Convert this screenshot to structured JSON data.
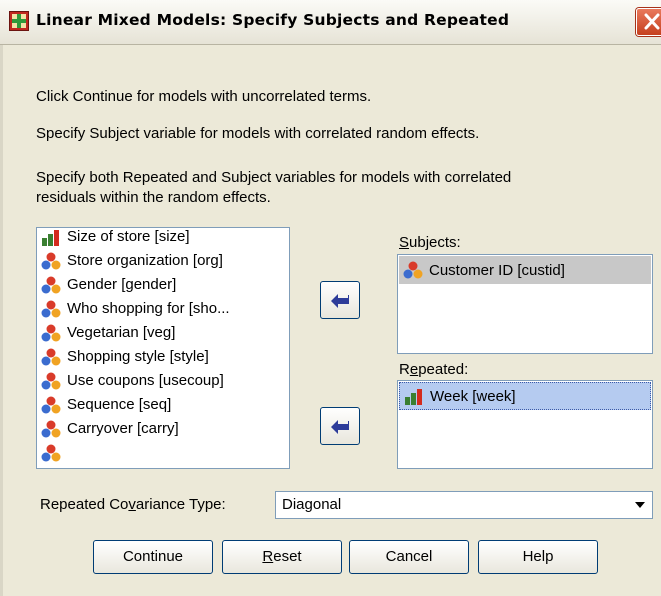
{
  "window": {
    "title": "Linear Mixed Models: Specify Subjects and Repeated"
  },
  "info": {
    "line1": "Click Continue for models with uncorrelated terms.",
    "line2": "Specify Subject variable for models with correlated random effects.",
    "line3a": "Specify both Repeated and Subject variables for models with correlated",
    "line3b": "residuals within the random effects."
  },
  "variables": [
    {
      "label": "Size of store [size]",
      "icon": "ordinal-bar-icon"
    },
    {
      "label": "Store organization [org]",
      "icon": "nominal-icon"
    },
    {
      "label": "Gender [gender]",
      "icon": "nominal-icon"
    },
    {
      "label": "Who shopping for [sho...",
      "icon": "nominal-icon"
    },
    {
      "label": "Vegetarian [veg]",
      "icon": "nominal-icon"
    },
    {
      "label": "Shopping style [style]",
      "icon": "nominal-icon"
    },
    {
      "label": "Use coupons [usecoup]",
      "icon": "nominal-icon"
    },
    {
      "label": "Sequence [seq]",
      "icon": "nominal-icon"
    },
    {
      "label": "Carryover [carry]",
      "icon": "nominal-icon"
    }
  ],
  "subjects": {
    "label_u": "S",
    "label_rest": "ubjects:",
    "items": [
      {
        "label": "Customer ID [custid]",
        "icon": "nominal-icon"
      }
    ]
  },
  "repeated": {
    "label_pre": "R",
    "label_u": "e",
    "label_rest": "peated:",
    "items": [
      {
        "label": "Week [week]",
        "icon": "ordinal-bar-icon"
      }
    ]
  },
  "covariance": {
    "label_pre": "Repeated Co",
    "label_u": "v",
    "label_rest": "ariance Type:",
    "value": "Diagonal"
  },
  "buttons": {
    "continue": "Continue",
    "reset_u": "R",
    "reset_rest": "eset",
    "cancel": "Cancel",
    "help": "Help"
  },
  "colors": {
    "dialog_bg": "#ece9d8",
    "selection_bg": "#b5cbf0",
    "selection_gray": "#c8c8c8",
    "close_red": "#d2502c"
  }
}
